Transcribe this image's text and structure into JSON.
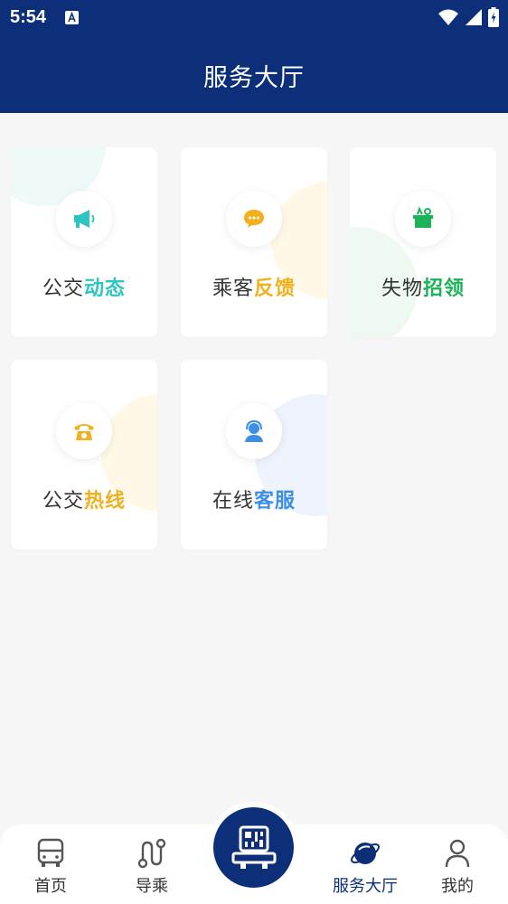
{
  "status_bar": {
    "time": "5:54"
  },
  "header": {
    "title": "服务大厅"
  },
  "cards": [
    {
      "plain": "公交",
      "highlight": "动态",
      "color": "#2ec4c4",
      "icon": "megaphone-icon"
    },
    {
      "plain": "乘客",
      "highlight": "反馈",
      "color": "#f2b01e",
      "icon": "chat-bubble-icon"
    },
    {
      "plain": "失物",
      "highlight": "招领",
      "color": "#1ab35a",
      "icon": "lost-found-box-icon"
    },
    {
      "plain": "公交",
      "highlight": "热线",
      "color": "#f2b01e",
      "icon": "telephone-icon"
    },
    {
      "plain": "在线",
      "highlight": "客服",
      "color": "#3c8ee8",
      "icon": "customer-service-icon"
    }
  ],
  "bottom_nav": {
    "home": "首页",
    "guide": "导乘",
    "service_hall": "服务大厅",
    "mine": "我的"
  },
  "colors": {
    "brand": "#0d2f7a",
    "background": "#f6f6f6"
  }
}
